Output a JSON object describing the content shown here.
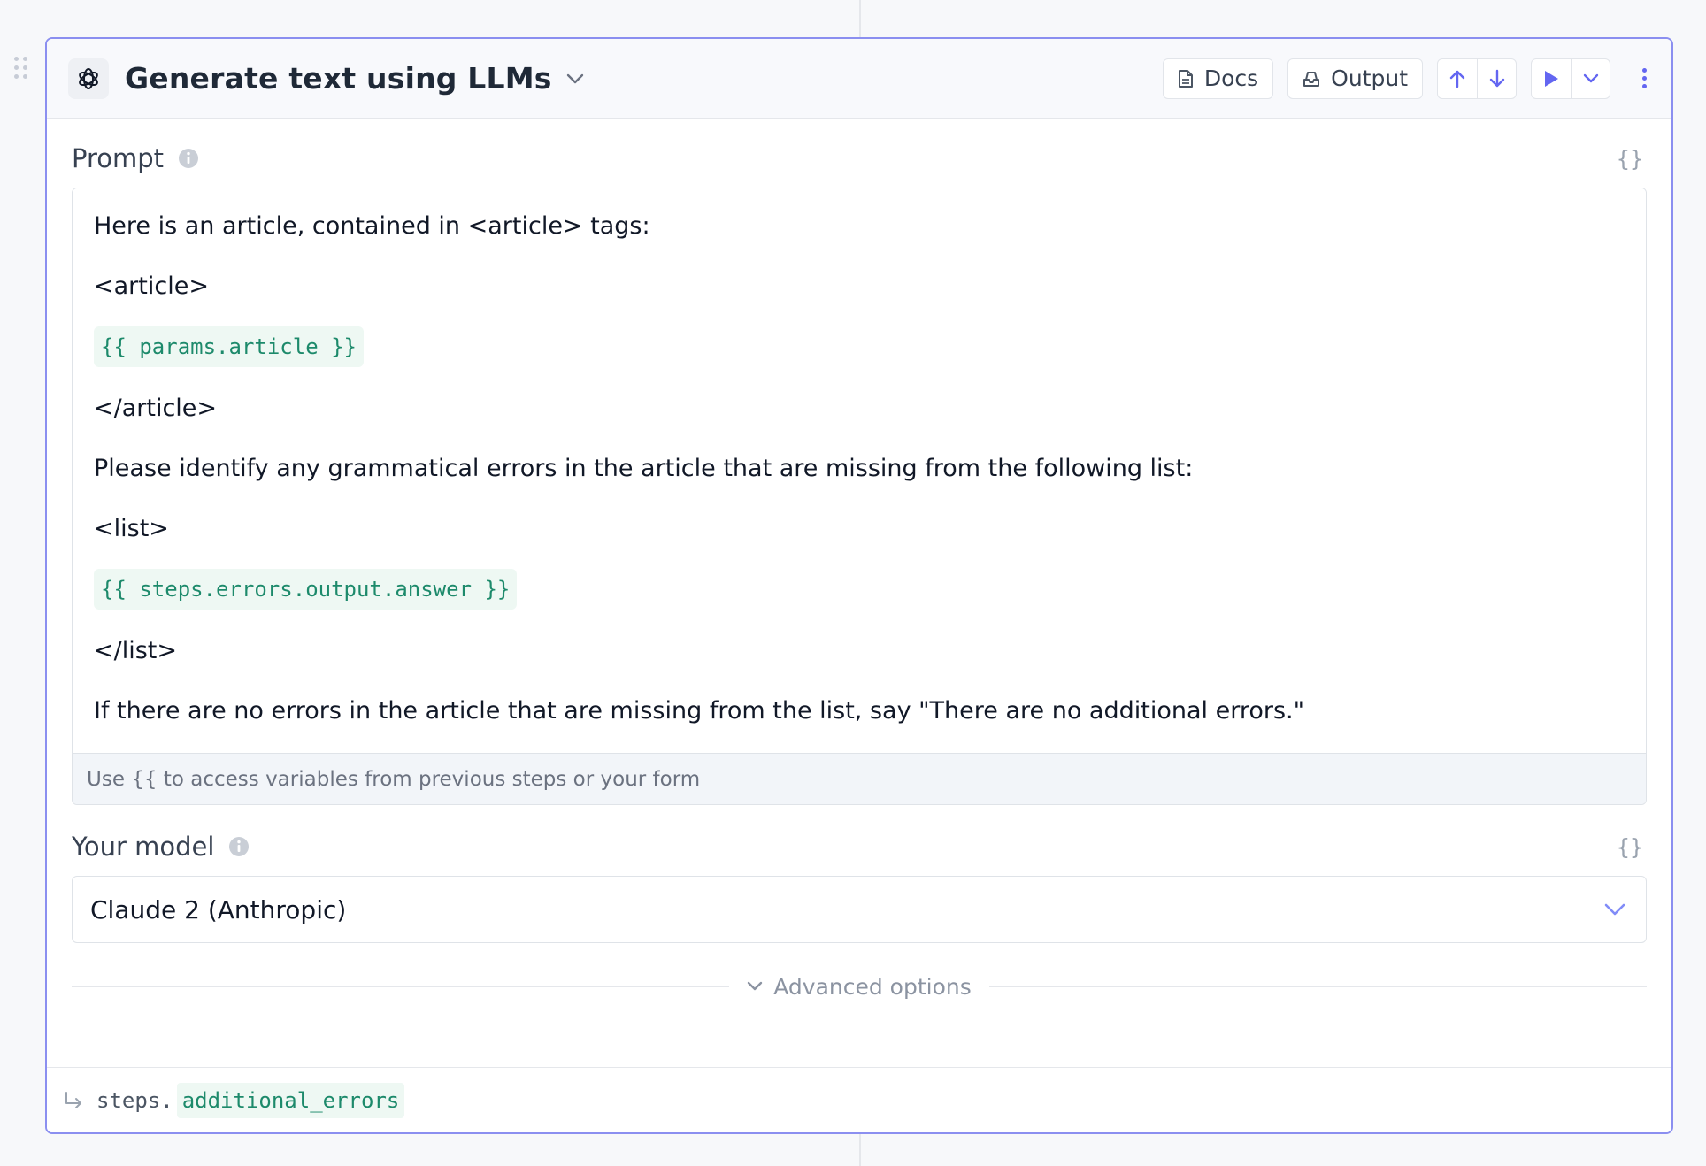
{
  "step": {
    "title": "Generate text using LLMs",
    "app_icon": "openai-logo-icon"
  },
  "header_buttons": {
    "docs_label": "Docs",
    "output_label": "Output"
  },
  "prompt": {
    "label": "Prompt",
    "code_toggle": "{}",
    "lines": {
      "l1": "Here is an article, contained in <article> tags:",
      "l2": "<article>",
      "v1": "{{ params.article }}",
      "l3": "</article>",
      "l4": "Please identify any grammatical errors in the article that are missing from the following list:",
      "l5": "<list>",
      "v2": "{{ steps.errors.output.answer }}",
      "l6": "</list>",
      "l7": "If there are no errors in the article that are missing from the list, say \"There are no additional errors.\""
    },
    "hint": "Use {{ to access variables from previous steps or your form"
  },
  "model": {
    "label": "Your model",
    "code_toggle": "{}",
    "selected": "Claude 2 (Anthropic)"
  },
  "advanced": {
    "label": "Advanced options"
  },
  "output": {
    "prefix": "steps.",
    "name": "additional_errors"
  },
  "colors": {
    "accent": "#6366f1",
    "card_border": "#8b8ff0",
    "variable_text": "#1d8a6b",
    "variable_bg": "#eef8f3"
  }
}
